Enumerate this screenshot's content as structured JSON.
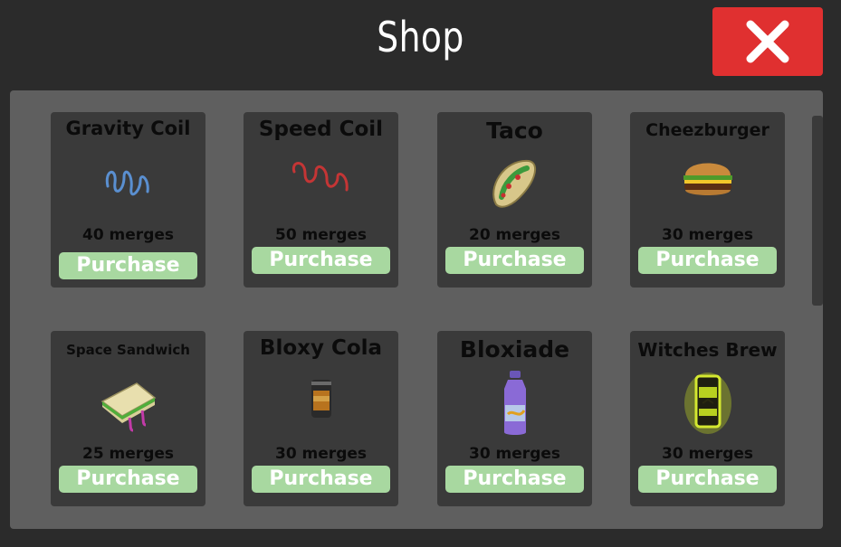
{
  "shop": {
    "title": "Shop",
    "close_icon": "close-x-icon",
    "colors": {
      "close": "#e03030",
      "purchase": "#a8d8a0",
      "card": "#3a3a3a",
      "panel": "#5f5f5f"
    },
    "items": [
      {
        "name": "Gravity Coil",
        "icon": "gravity-coil-icon",
        "cost": "40 merges",
        "button": "Purchase"
      },
      {
        "name": "Speed Coil",
        "icon": "speed-coil-icon",
        "cost": "50 merges",
        "button": "Purchase"
      },
      {
        "name": "Taco",
        "icon": "taco-icon",
        "cost": "20 merges",
        "button": "Purchase"
      },
      {
        "name": "Cheezburger",
        "icon": "burger-icon",
        "cost": "30 merges",
        "button": "Purchase"
      },
      {
        "name": "Space Sandwich",
        "icon": "sandwich-icon",
        "cost": "25 merges",
        "button": "Purchase"
      },
      {
        "name": "Bloxy Cola",
        "icon": "cola-can-icon",
        "cost": "30 merges",
        "button": "Purchase"
      },
      {
        "name": "Bloxiade",
        "icon": "sports-drink-bottle-icon",
        "cost": "30 merges",
        "button": "Purchase"
      },
      {
        "name": "Witches Brew",
        "icon": "brew-can-icon",
        "cost": "30 merges",
        "button": "Purchase"
      }
    ]
  }
}
